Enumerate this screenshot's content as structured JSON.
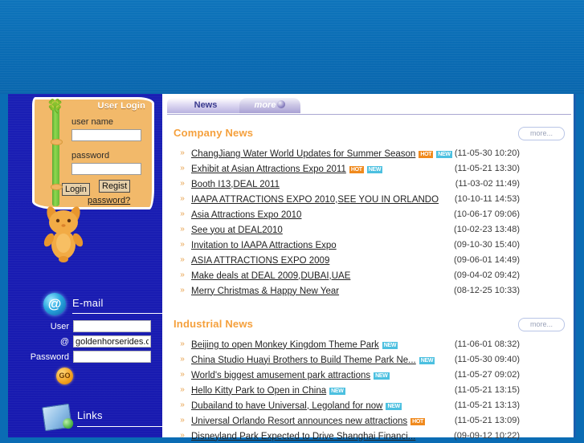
{
  "banner": {
    "name": "site-banner"
  },
  "sidebar": {
    "login": {
      "title": "User Login",
      "username_label": "user name",
      "username_value": "",
      "username_placeholder": "",
      "password_label": "password",
      "password_value": "",
      "password_placeholder": "",
      "login_button": "Login",
      "regist_button": "Regist",
      "forgot_link": "password?"
    },
    "email": {
      "heading": "E-mail",
      "icon": "at-sign-icon",
      "user_label": "User",
      "user_value": "",
      "domain_label": "@",
      "domain_value": "goldenhorserides.com",
      "password_label": "Password",
      "password_value": "",
      "go_button": "GO"
    },
    "links": {
      "heading": "Links",
      "icon": "links-book-icon"
    }
  },
  "main": {
    "tabs": [
      {
        "label": "News",
        "name": "tab-news"
      },
      {
        "label": "more",
        "name": "tab-more"
      }
    ],
    "sections": [
      {
        "title": "Company News",
        "more_label": "more...",
        "items": [
          {
            "title": "ChangJiang Water World Updates for Summer Season",
            "badges": [
              "HOT",
              "NEW"
            ],
            "date": "(11-05-30 10:20)"
          },
          {
            "title": "Exhibit at Asian Attractions Expo 2011",
            "badges": [
              "HOT",
              "NEW"
            ],
            "date": "(11-05-21 13:30)"
          },
          {
            "title": "Booth I13,DEAL 2011",
            "badges": [],
            "date": "(11-03-02 11:49)"
          },
          {
            "title": "IAAPA ATTRACTIONS EXPO 2010,SEE YOU IN ORLANDO",
            "badges": [],
            "date": "(10-10-11 14:53)"
          },
          {
            "title": "Asia Attractions Expo 2010",
            "badges": [],
            "date": "(10-06-17 09:06)"
          },
          {
            "title": "See you at DEAL2010",
            "badges": [],
            "date": "(10-02-23 13:48)"
          },
          {
            "title": "Invitation to IAAPA Attractions Expo",
            "badges": [],
            "date": "(09-10-30 15:40)"
          },
          {
            "title": "ASIA ATTRACTIONS EXPO 2009",
            "badges": [],
            "date": "(09-06-01 14:49)"
          },
          {
            "title": "Make deals at DEAL 2009,DUBAI,UAE",
            "badges": [],
            "date": "(09-04-02 09:42)"
          },
          {
            "title": "Merry Christmas & Happy New Year",
            "badges": [],
            "date": "(08-12-25 10:33)"
          }
        ]
      },
      {
        "title": "Industrial News",
        "more_label": "more...",
        "items": [
          {
            "title": "Beijing to open Monkey Kingdom Theme Park",
            "badges": [
              "NEW"
            ],
            "date": "(11-06-01 08:32)"
          },
          {
            "title": "China Studio Huayi Brothers to Build Theme Park Ne...",
            "badges": [
              "NEW"
            ],
            "date": "(11-05-30 09:40)"
          },
          {
            "title": "World's biggest amusement park attractions",
            "badges": [
              "NEW"
            ],
            "date": "(11-05-27 09:02)"
          },
          {
            "title": "Hello Kitty Park to Open in China",
            "badges": [
              "NEW"
            ],
            "date": "(11-05-21 13:15)"
          },
          {
            "title": "Dubailand to have Universal, Legoland for now",
            "badges": [
              "NEW"
            ],
            "date": "(11-05-21 13:13)"
          },
          {
            "title": "Universal Orlando Resort announces new attractions",
            "badges": [
              "HOT"
            ],
            "date": "(11-05-21 13:09)"
          },
          {
            "title": "Disneyland Park Expected to Drive Shanghai Financi...",
            "badges": [],
            "date": "(09-09-12 10:22)"
          }
        ]
      }
    ]
  },
  "colors": {
    "banner_blue": "#0a6cb4",
    "sidebar_blue": "#1a1fb4",
    "accent_orange": "#f5a03c",
    "tab_purple": "#3a3a8e",
    "badge_hot": "#f08a1e",
    "badge_new": "#4cc0e0"
  },
  "icons": {
    "bullet": "double-chevron-right-icon",
    "clover": "clover-icon",
    "mascot": "bunny-mascot-icon"
  }
}
